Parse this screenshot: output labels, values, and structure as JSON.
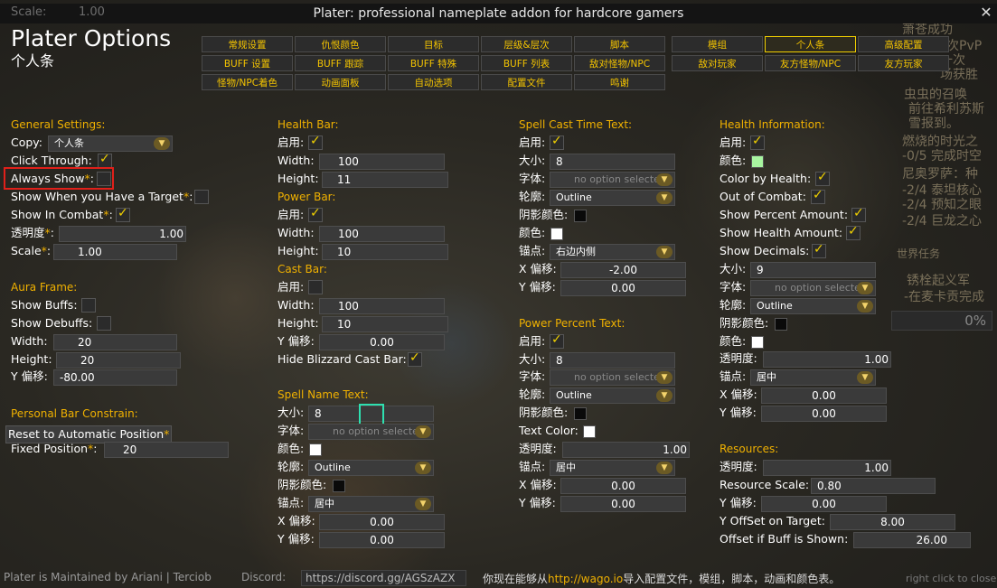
{
  "window": {
    "title": "Plater: professional nameplate addon for hardcore gamers",
    "scale_label": "Scale:",
    "scale_value": "1.00",
    "close": "✕"
  },
  "header": {
    "title": "Plater Options",
    "subtitle": "个人条"
  },
  "tabs": [
    {
      "label": "常规设置"
    },
    {
      "label": "仇恨颜色"
    },
    {
      "label": "目标"
    },
    {
      "label": "层级&层次"
    },
    {
      "label": "脚本"
    },
    {
      "label": "模组"
    },
    {
      "label": "个人条",
      "active": true
    },
    {
      "label": "高级配置"
    },
    {
      "label": "BUFF 设置"
    },
    {
      "label": "BUFF 跟踪"
    },
    {
      "label": "BUFF 特殊"
    },
    {
      "label": "BUFF 列表"
    },
    {
      "label": "敌对怪物/NPC"
    },
    {
      "label": "敌对玩家"
    },
    {
      "label": "友方怪物/NPC"
    },
    {
      "label": "友方玩家"
    },
    {
      "label": "怪物/NPC着色"
    },
    {
      "label": "动画面板"
    },
    {
      "label": "自动选项"
    },
    {
      "label": "配置文件"
    },
    {
      "label": "鸣谢"
    }
  ],
  "col1": {
    "general_title": "General Settings:",
    "copy_label": "Copy:",
    "copy_value": "个人条",
    "click_through": "Click Through:",
    "always_show": "Always Show",
    "show_target": "Show When you Have a Target",
    "show_combat": "Show In Combat",
    "alpha_label": "透明度",
    "alpha_value": "1.00",
    "scale_label": "Scale",
    "scale_value": "1.00",
    "aura_title": "Aura Frame:",
    "show_buffs": "Show Buffs:",
    "show_debuffs": "Show Debuffs:",
    "width_label": "Width:",
    "width_value": "20",
    "height_label": "Height:",
    "height_value": "20",
    "yoff_label": "Y 偏移:",
    "yoff_value": "-80.00",
    "constrain_title": "Personal Bar Constrain:",
    "reset_label": "Reset to Automatic Position",
    "fixed_label": "Fixed Position",
    "fixed_value": "20",
    "asterisk": "*",
    "colon": ":"
  },
  "col2": {
    "health_title": "Health Bar:",
    "enable": "启用:",
    "width": "Width:",
    "height": "Height:",
    "hb_width": "100",
    "hb_height": "11",
    "power_title": "Power Bar:",
    "pb_width": "100",
    "pb_height": "10",
    "cast_title": "Cast Bar:",
    "cb_width": "100",
    "cb_height": "10",
    "yoff": "Y 偏移:",
    "cb_yoff": "0.00",
    "hide_blizz": "Hide Blizzard Cast Bar:",
    "spell_title": "Spell Name Text:",
    "size": "大小:",
    "sn_size": "8",
    "font": "字体:",
    "no_option": "no option selecte",
    "color": "颜色:",
    "outline": "轮廓:",
    "outline_value": "Outline",
    "shadow": "阴影颜色:",
    "anchor": "锚点:",
    "anchor_value": "居中",
    "xoff": "X 偏移:",
    "sn_xoff": "0.00",
    "sn_yoff": "0.00"
  },
  "col3": {
    "cast_time_title": "Spell Cast Time Text:",
    "enable": "启用:",
    "size": "大小:",
    "ct_size": "8",
    "font": "字体:",
    "no_option": "no option selecte",
    "outline": "轮廓:",
    "outline_value": "Outline",
    "shadow": "阴影颜色:",
    "color": "颜色:",
    "anchor": "锚点:",
    "ct_anchor": "右边内侧",
    "xoff": "X 偏移:",
    "ct_xoff": "-2.00",
    "yoff": "Y 偏移:",
    "ct_yoff": "0.00",
    "power_pct_title": "Power Percent Text:",
    "pp_size": "8",
    "text_color": "Text Color:",
    "alpha": "透明度:",
    "pp_alpha": "1.00",
    "pp_anchor": "居中",
    "pp_xoff": "0.00",
    "pp_yoff": "0.00"
  },
  "col4": {
    "health_info_title": "Health Information:",
    "enable": "启用:",
    "color": "颜色:",
    "color_by_health": "Color by Health:",
    "out_of_combat": "Out of Combat:",
    "show_percent": "Show Percent Amount:",
    "show_health": "Show Health Amount:",
    "show_decimals": "Show Decimals:",
    "size": "大小:",
    "hi_size": "9",
    "font": "字体:",
    "no_option": "no option selecte",
    "outline": "轮廓:",
    "outline_value": "Outline",
    "shadow": "阴影颜色:",
    "alpha": "透明度:",
    "hi_alpha": "1.00",
    "anchor": "锚点:",
    "hi_anchor": "居中",
    "xoff": "X 偏移:",
    "hi_xoff": "0.00",
    "yoff": "Y 偏移:",
    "hi_yoff": "0.00",
    "resources_title": "Resources:",
    "res_alpha": "1.00",
    "res_scale_label": "Resource Scale:",
    "res_scale": "0.80",
    "res_yoff": "0.00",
    "y_offset_target": "Y OffSet on Target:",
    "y_offset_target_value": "8.00",
    "offset_buff": "Offset if Buff is Shown:",
    "offset_buff_value": "26.00"
  },
  "quest_tracker": {
    "lines": [
      "萧苍成功",
      "一次PvP",
      "一次",
      "场获胜",
      "虫虫的召唤",
      "前往希利苏斯",
      "雪报到。",
      "燃烧的时光之",
      "-0/5 完成时空",
      "尼奥罗萨：种",
      "-2/4 泰坦核心",
      "-2/4 预知之眼",
      "-2/4 巨龙之心",
      "世界任务",
      "锈栓起义军",
      "-在麦卡贡完成"
    ],
    "progress": "0%"
  },
  "footer": {
    "maintained": "Plater is Maintained by Ariani | Terciob",
    "discord_label": "Discord:",
    "discord_url": "https://discord.gg/AGSzAZX",
    "text_before": "你现在能够从",
    "wago": "http://wago.io",
    "text_after": "导入配置文件，模组，脚本，动画和颜色表。",
    "right_hint": "right click to close"
  },
  "colors": {
    "accent": "#f0b100",
    "tab_text": "#f4c400",
    "health_color": "#a8f5a0",
    "highlight_red": "#e0201a",
    "highlight_teal": "#2ee0b0"
  },
  "icons": {
    "dropdown": "chevron-down-icon",
    "check": "checkmark-icon",
    "close": "close-icon"
  }
}
